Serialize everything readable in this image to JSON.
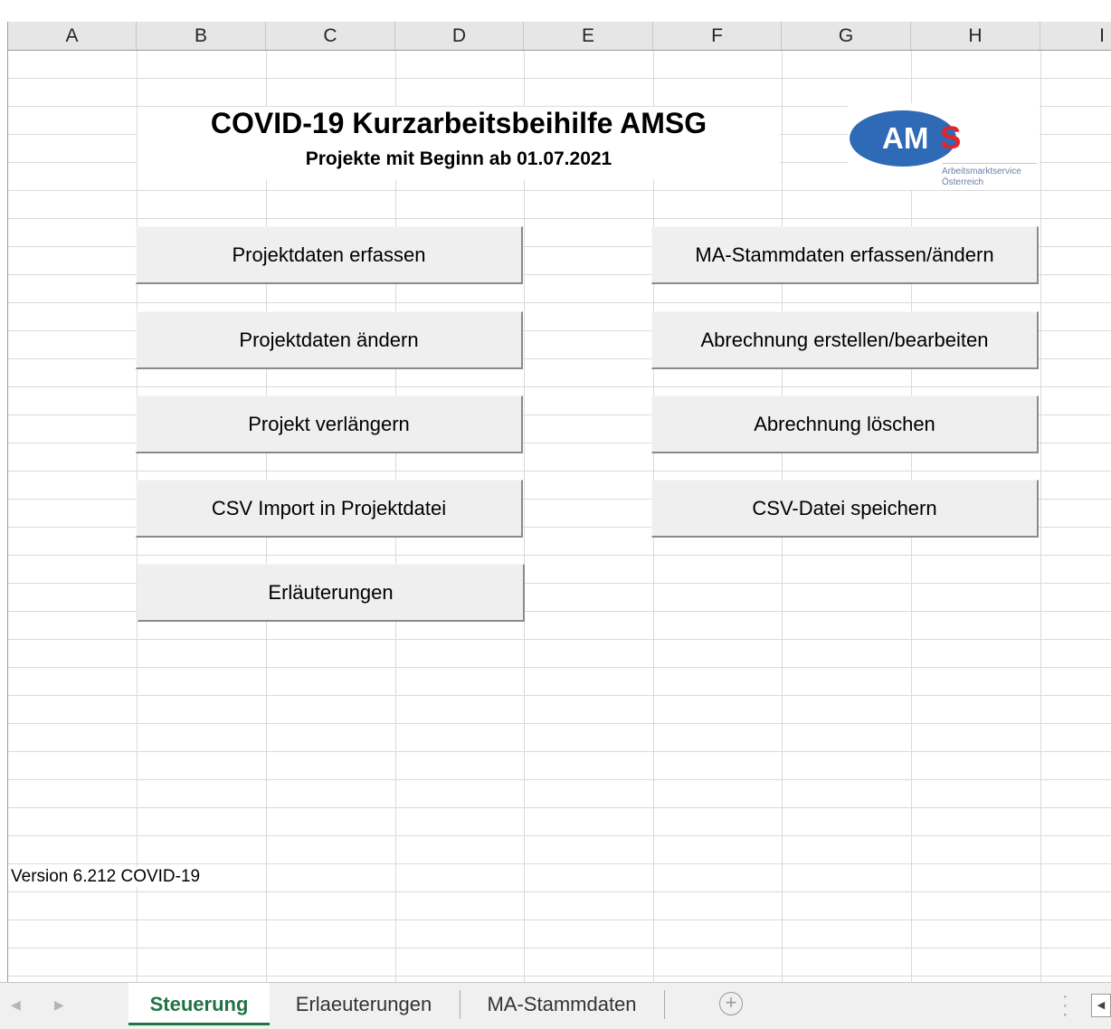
{
  "columns": [
    "A",
    "B",
    "C",
    "D",
    "E",
    "F",
    "G",
    "H",
    "I"
  ],
  "sheet": {
    "title": "COVID-19 Kurzarbeitsbeihilfe AMSG",
    "subtitle": "Projekte mit Beginn ab 01.07.2021",
    "version": "Version 6.212 COVID-19"
  },
  "logo": {
    "am": "AM",
    "s": "S",
    "line1": "Arbeitsmarktservice",
    "line2": "Österreich",
    "brand_blue": "#2f6ab6",
    "brand_red": "#e0262b"
  },
  "buttons": {
    "projektdaten_erfassen": "Projektdaten erfassen",
    "projektdaten_aendern": "Projektdaten ändern",
    "projekt_verlaengern": "Projekt verlängern",
    "csv_import": "CSV Import in Projektdatei",
    "erlaeuterungen": "Erläuterungen",
    "ma_stammdaten": "MA-Stammdaten erfassen/ändern",
    "abrechnung_erstellen": "Abrechnung erstellen/bearbeiten",
    "abrechnung_loeschen": "Abrechnung löschen",
    "csv_speichern": "CSV-Datei speichern"
  },
  "tabs": {
    "steuerung": "Steuerung",
    "erlaeuterungen": "Erlaeuterungen",
    "ma_stammdaten": "MA-Stammdaten",
    "active_color": "#217346"
  }
}
